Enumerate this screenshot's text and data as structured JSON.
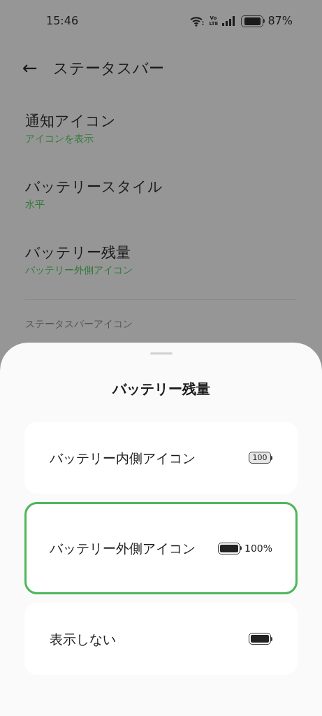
{
  "status_bar": {
    "time": "15:46",
    "volte": "Vo LTE",
    "battery": "87%"
  },
  "header": {
    "back": "←",
    "title": "ステータスバー"
  },
  "settings": [
    {
      "label": "通知アイコン",
      "value": "アイコンを表示"
    },
    {
      "label": "バッテリースタイル",
      "value": "水平"
    },
    {
      "label": "バッテリー残量",
      "value": "バッテリー外側アイコン"
    }
  ],
  "section_heading": "ステータスバーアイコン",
  "sheet": {
    "title": "バッテリー残量",
    "options": [
      {
        "label": "バッテリー内側アイコン",
        "kind": "inside",
        "icon_text": "100",
        "selected": false
      },
      {
        "label": "バッテリー外側アイコン",
        "kind": "outside",
        "icon_text": "100%",
        "selected": true
      },
      {
        "label": "表示しない",
        "kind": "hidden",
        "selected": false
      }
    ]
  }
}
